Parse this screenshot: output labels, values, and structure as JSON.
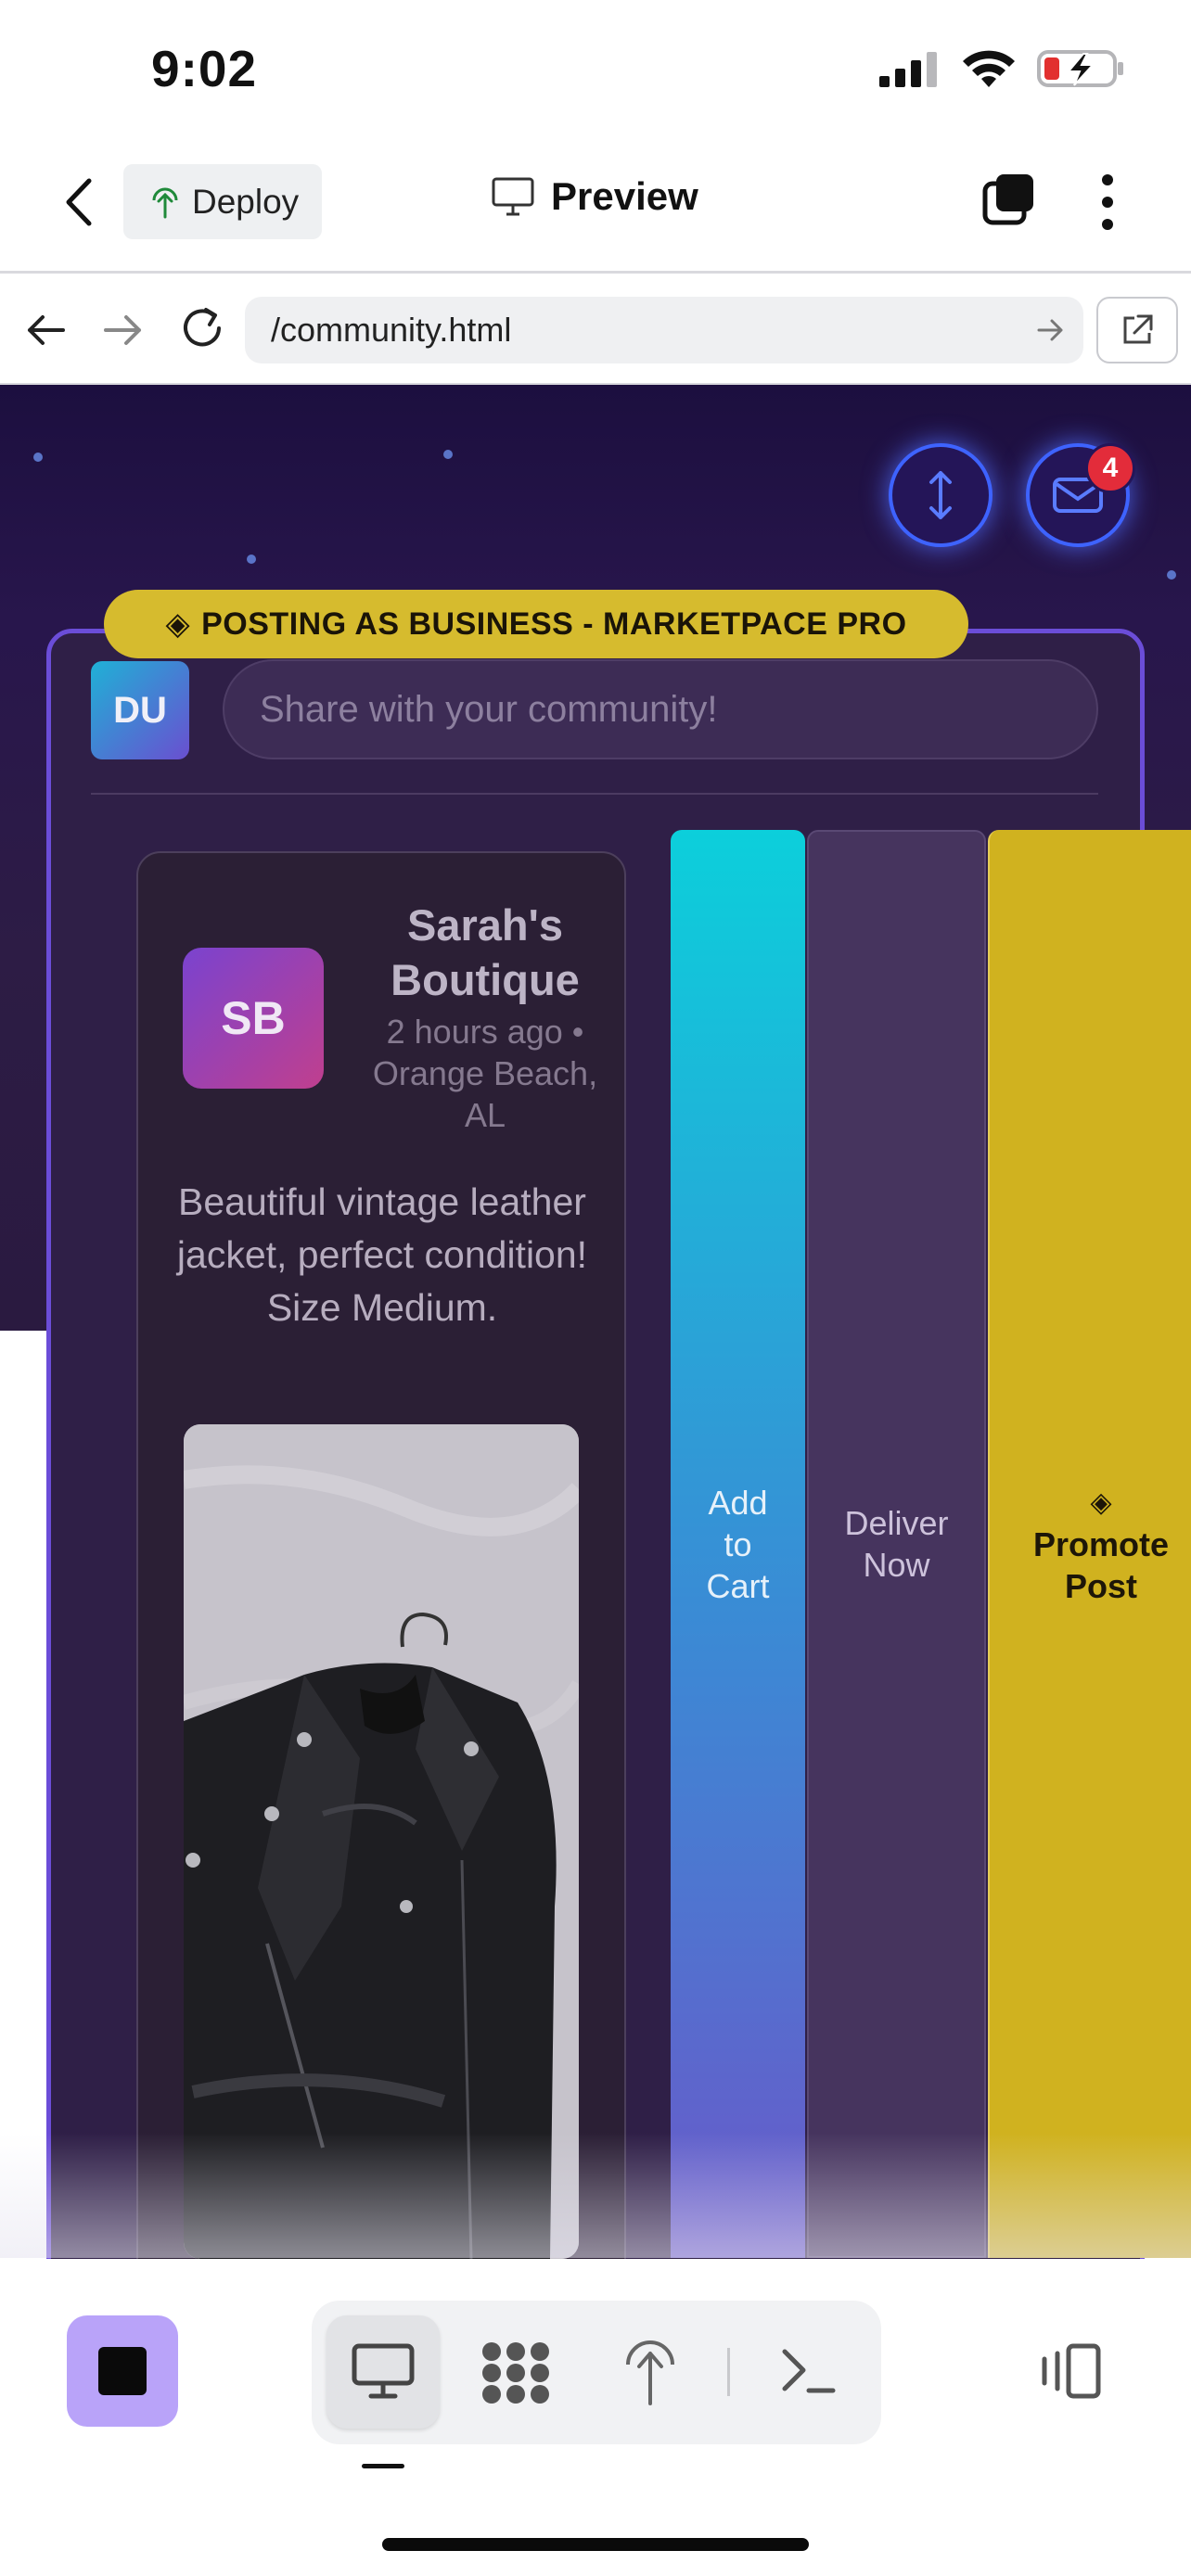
{
  "status_bar": {
    "time": "9:02"
  },
  "header": {
    "deploy_label": "Deploy",
    "preview_label": "Preview"
  },
  "browser": {
    "url": "/community.html"
  },
  "floating": {
    "inbox_badge": "4"
  },
  "composer": {
    "business_banner": "POSTING AS BUSINESS - MARKETPACE PRO",
    "avatar_initials": "DU",
    "placeholder": "Share with your community!"
  },
  "post": {
    "avatar_initials": "SB",
    "seller_name": "Sarah's Boutique",
    "meta": "2 hours ago • Orange Beach, AL",
    "text": "Beautiful vintage leather jacket, perfect condition! Size Medium."
  },
  "actions": {
    "add_to_cart": "Add to Cart",
    "deliver_now": "Deliver Now",
    "promote_icon": "◈",
    "promote_post": "Promote Post"
  },
  "colors": {
    "accent_purple": "#b9a3f9",
    "banner_gold": "#d6bb2e",
    "badge_red": "#e32c3a",
    "glow_blue": "#3e63ff"
  },
  "icons": {
    "banner_icon": "◈",
    "toolbar": [
      "desktop-icon",
      "grid-icon",
      "deploy-icon",
      "terminal-icon",
      "device-switch-icon"
    ]
  }
}
